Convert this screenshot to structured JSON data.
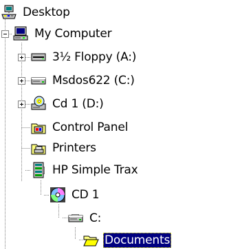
{
  "tree": {
    "items": [
      {
        "label": "Desktop",
        "icon": "desktop-icon"
      },
      {
        "label": "My Computer",
        "icon": "my-computer-icon"
      },
      {
        "label": "3½ Floppy (A:)",
        "icon": "floppy-drive-icon"
      },
      {
        "label": "Msdos622 (C:)",
        "icon": "hard-drive-icon"
      },
      {
        "label": "Cd 1 (D:)",
        "icon": "cd-drive-icon"
      },
      {
        "label": "Control Panel",
        "icon": "control-panel-icon"
      },
      {
        "label": "Printers",
        "icon": "printers-folder-icon"
      },
      {
        "label": "HP Simple Trax",
        "icon": "hp-simple-trax-icon"
      },
      {
        "label": "CD 1",
        "icon": "cd-disc-icon"
      },
      {
        "label": "C:",
        "icon": "hard-drive-icon"
      },
      {
        "label": "Documents",
        "icon": "open-folder-icon"
      }
    ]
  },
  "colors": {
    "selection_background": "#000080",
    "selection_text": "#ffffff",
    "tree_line": "#808080"
  }
}
